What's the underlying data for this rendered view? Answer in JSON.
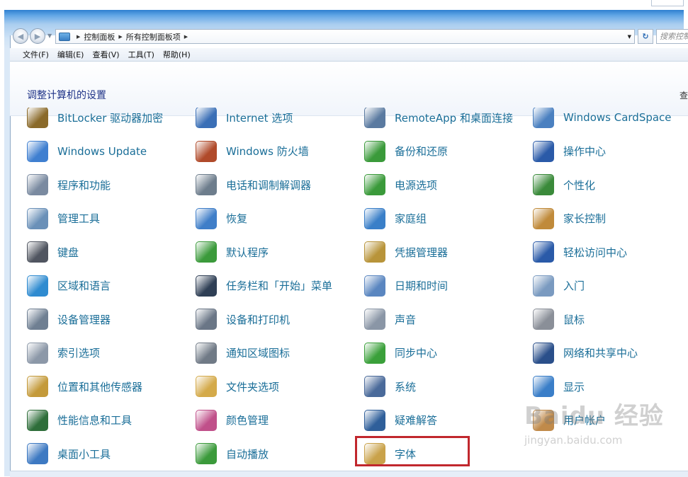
{
  "address": {
    "crumbs": [
      "控制面板",
      "所有控制面板项"
    ],
    "search_placeholder": "搜索控制"
  },
  "menu": [
    "文件(F)",
    "编辑(E)",
    "查看(V)",
    "工具(T)",
    "帮助(H)"
  ],
  "header": {
    "title": "调整计算机的设置",
    "view_by": "查"
  },
  "columns": [
    [
      {
        "label": "BitLocker 驱动器加密",
        "icon": "bitlocker-icon",
        "color": "#8a6a2a"
      },
      {
        "label": "Windows Update",
        "icon": "windows-update-icon",
        "color": "#3f7fd0"
      },
      {
        "label": "程序和功能",
        "icon": "programs-icon",
        "color": "#7a8aa0"
      },
      {
        "label": "管理工具",
        "icon": "admin-tools-icon",
        "color": "#6a90b8"
      },
      {
        "label": "键盘",
        "icon": "keyboard-icon",
        "color": "#505560"
      },
      {
        "label": "区域和语言",
        "icon": "region-icon",
        "color": "#2f8bd0"
      },
      {
        "label": "设备管理器",
        "icon": "device-manager-icon",
        "color": "#6f7f92"
      },
      {
        "label": "索引选项",
        "icon": "indexing-icon",
        "color": "#8c98a8"
      },
      {
        "label": "位置和其他传感器",
        "icon": "sensor-icon",
        "color": "#c49a3a"
      },
      {
        "label": "性能信息和工具",
        "icon": "performance-icon",
        "color": "#2e6e3a"
      },
      {
        "label": "桌面小工具",
        "icon": "gadgets-icon",
        "color": "#3d79c2"
      }
    ],
    [
      {
        "label": "Internet 选项",
        "icon": "internet-options-icon",
        "color": "#3a6fb6"
      },
      {
        "label": "Windows 防火墙",
        "icon": "firewall-icon",
        "color": "#b04a2a"
      },
      {
        "label": "电话和调制解调器",
        "icon": "phone-modem-icon",
        "color": "#6d7d8c"
      },
      {
        "label": "恢复",
        "icon": "recovery-icon",
        "color": "#3f7ec8"
      },
      {
        "label": "默认程序",
        "icon": "default-programs-icon",
        "color": "#3b9a3b"
      },
      {
        "label": "任务栏和「开始」菜单",
        "icon": "taskbar-icon",
        "color": "#2f3f55"
      },
      {
        "label": "设备和打印机",
        "icon": "printer-icon",
        "color": "#6a7686"
      },
      {
        "label": "通知区域图标",
        "icon": "notification-icon",
        "color": "#707a86"
      },
      {
        "label": "文件夹选项",
        "icon": "folder-options-icon",
        "color": "#d4aa4a"
      },
      {
        "label": "颜色管理",
        "icon": "color-management-icon",
        "color": "#c0508a"
      },
      {
        "label": "自动播放",
        "icon": "autoplay-icon",
        "color": "#3b9a3b"
      }
    ],
    [
      {
        "label": "RemoteApp 和桌面连接",
        "icon": "remoteapp-icon",
        "color": "#5a7aa0"
      },
      {
        "label": "备份和还原",
        "icon": "backup-icon",
        "color": "#3a9a3a"
      },
      {
        "label": "电源选项",
        "icon": "power-icon",
        "color": "#3a9a3a"
      },
      {
        "label": "家庭组",
        "icon": "homegroup-icon",
        "color": "#3a7fc8"
      },
      {
        "label": "凭据管理器",
        "icon": "credential-icon",
        "color": "#b8943a"
      },
      {
        "label": "日期和时间",
        "icon": "datetime-icon",
        "color": "#5a86c0"
      },
      {
        "label": "声音",
        "icon": "sound-icon",
        "color": "#8a96a6"
      },
      {
        "label": "同步中心",
        "icon": "sync-icon",
        "color": "#3aa03a"
      },
      {
        "label": "系统",
        "icon": "system-icon",
        "color": "#4a6a9a"
      },
      {
        "label": "疑难解答",
        "icon": "troubleshoot-icon",
        "color": "#2f5f9a"
      },
      {
        "label": "字体",
        "icon": "fonts-icon",
        "color": "#c9a24a"
      }
    ],
    [
      {
        "label": "Windows CardSpace",
        "icon": "cardspace-icon",
        "color": "#4a80c0"
      },
      {
        "label": "操作中心",
        "icon": "action-center-icon",
        "color": "#2a5aa8"
      },
      {
        "label": "个性化",
        "icon": "personalization-icon",
        "color": "#3a8a3a"
      },
      {
        "label": "家长控制",
        "icon": "parental-icon",
        "color": "#c08a3a"
      },
      {
        "label": "轻松访问中心",
        "icon": "ease-access-icon",
        "color": "#2a5aa8"
      },
      {
        "label": "入门",
        "icon": "getting-started-icon",
        "color": "#7a9ac0"
      },
      {
        "label": "鼠标",
        "icon": "mouse-icon",
        "color": "#8a8f98"
      },
      {
        "label": "网络和共享中心",
        "icon": "network-icon",
        "color": "#2a4f8a"
      },
      {
        "label": "显示",
        "icon": "display-icon",
        "color": "#3a7ec8"
      },
      {
        "label": "用户帐户",
        "icon": "user-accounts-icon",
        "color": "#c08a4a"
      }
    ]
  ],
  "watermark": {
    "main": "Baidu 经验",
    "sub": "jingyan.baidu.com"
  }
}
